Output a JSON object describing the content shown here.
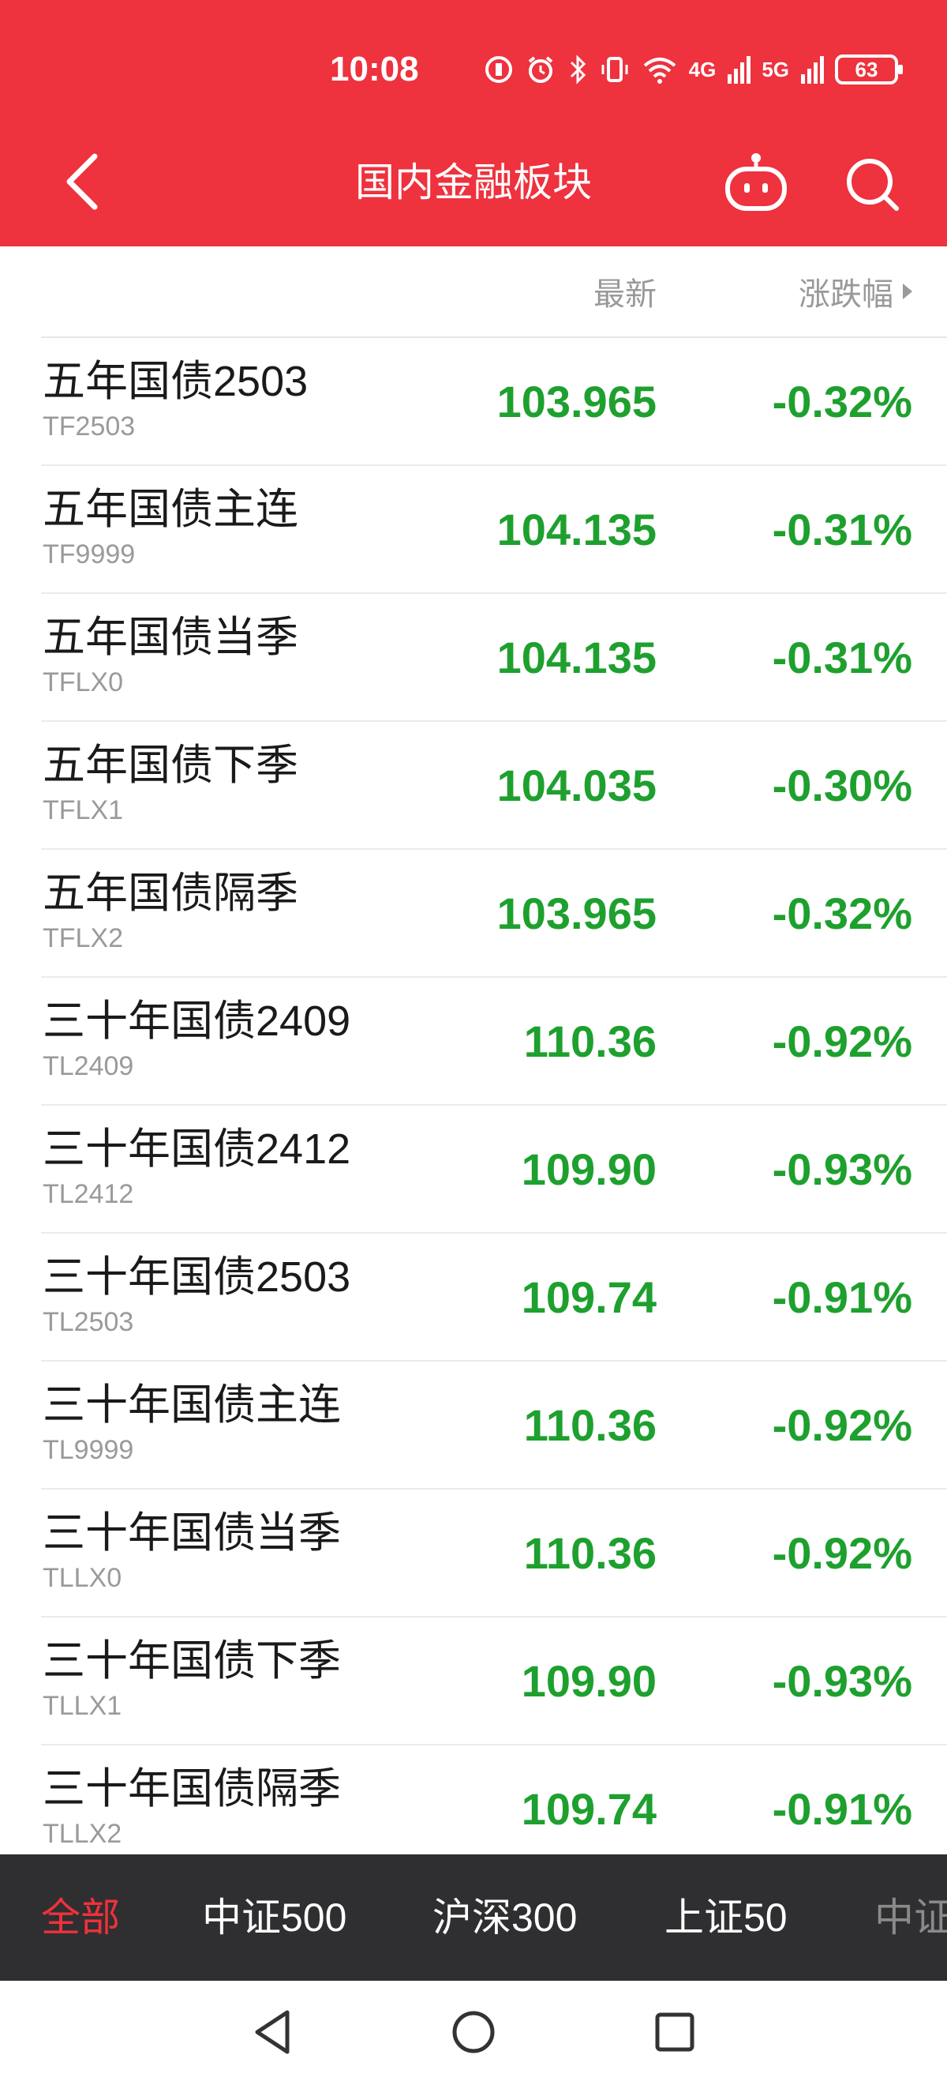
{
  "status_bar": {
    "time": "10:08",
    "network_1": "4G",
    "network_2": "5G",
    "battery": "63"
  },
  "header": {
    "title": "国内金融板块"
  },
  "columns": {
    "latest": "最新",
    "change": "涨跌幅"
  },
  "rows": [
    {
      "name": "五年国债2503",
      "code": "TF2503",
      "price": "103.965",
      "change": "-0.32%"
    },
    {
      "name": "五年国债主连",
      "code": "TF9999",
      "price": "104.135",
      "change": "-0.31%"
    },
    {
      "name": "五年国债当季",
      "code": "TFLX0",
      "price": "104.135",
      "change": "-0.31%"
    },
    {
      "name": "五年国债下季",
      "code": "TFLX1",
      "price": "104.035",
      "change": "-0.30%"
    },
    {
      "name": "五年国债隔季",
      "code": "TFLX2",
      "price": "103.965",
      "change": "-0.32%"
    },
    {
      "name": "三十年国债2409",
      "code": "TL2409",
      "price": "110.36",
      "change": "-0.92%"
    },
    {
      "name": "三十年国债2412",
      "code": "TL2412",
      "price": "109.90",
      "change": "-0.93%"
    },
    {
      "name": "三十年国债2503",
      "code": "TL2503",
      "price": "109.74",
      "change": "-0.91%"
    },
    {
      "name": "三十年国债主连",
      "code": "TL9999",
      "price": "110.36",
      "change": "-0.92%"
    },
    {
      "name": "三十年国债当季",
      "code": "TLLX0",
      "price": "110.36",
      "change": "-0.92%"
    },
    {
      "name": "三十年国债下季",
      "code": "TLLX1",
      "price": "109.90",
      "change": "-0.93%"
    },
    {
      "name": "三十年国债隔季",
      "code": "TLLX2",
      "price": "109.74",
      "change": "-0.91%"
    }
  ],
  "tabs": [
    {
      "label": "全部",
      "active": true
    },
    {
      "label": "中证500",
      "active": false
    },
    {
      "label": "沪深300",
      "active": false
    },
    {
      "label": "上证50",
      "active": false
    },
    {
      "label": "中证",
      "active": false
    }
  ],
  "colors": {
    "header_red": "#ee323e",
    "down_green": "#1ea02e",
    "active_tab": "#f0313c",
    "tab_bar": "#2f2f31"
  },
  "icons": [
    "back-arrow-icon",
    "robot-icon",
    "search-icon",
    "nav-back-icon",
    "nav-home-icon",
    "nav-recents-icon"
  ]
}
